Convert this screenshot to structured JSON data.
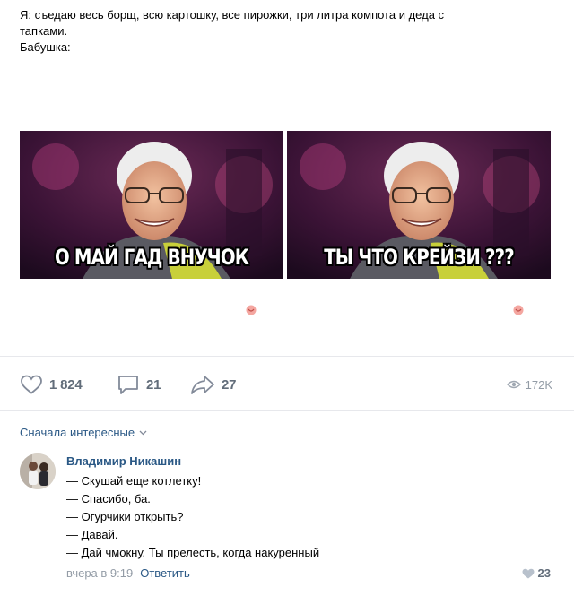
{
  "post": {
    "text_lines": [
      "Я: съедаю весь борщ, всю картошку, все пирожки, три литра компота и деда с",
      "тапками.",
      "Бабушка:"
    ],
    "images": [
      {
        "caption": "О МАЙ ГАД ВНУЧОК"
      },
      {
        "caption": "ТЫ ЧТО КРЕЙЗИ ???"
      }
    ]
  },
  "actions": {
    "likes": "1 824",
    "comments": "21",
    "shares": "27",
    "views": "172K"
  },
  "comments_section": {
    "sort_label": "Сначала интересные",
    "comment": {
      "author": "Владимир Никашин",
      "lines": [
        "— Скушай еще котлетку!",
        "— Спасибо, ба.",
        "— Огурчики открыть?",
        "— Давай.",
        "— Дай чмокну. Ты прелесть, когда накуренный"
      ],
      "time": "вчера в 9:19",
      "reply_label": "Ответить",
      "likes": "23"
    }
  },
  "colors": {
    "link": "#2a5885",
    "icon": "#828a99",
    "muted": "#939ca6",
    "divider": "#e7e8ec"
  },
  "icons": [
    "heart-icon",
    "comment-icon",
    "share-icon",
    "eye-icon",
    "chevron-down-icon",
    "small-heart-icon",
    "reaction-icon"
  ]
}
